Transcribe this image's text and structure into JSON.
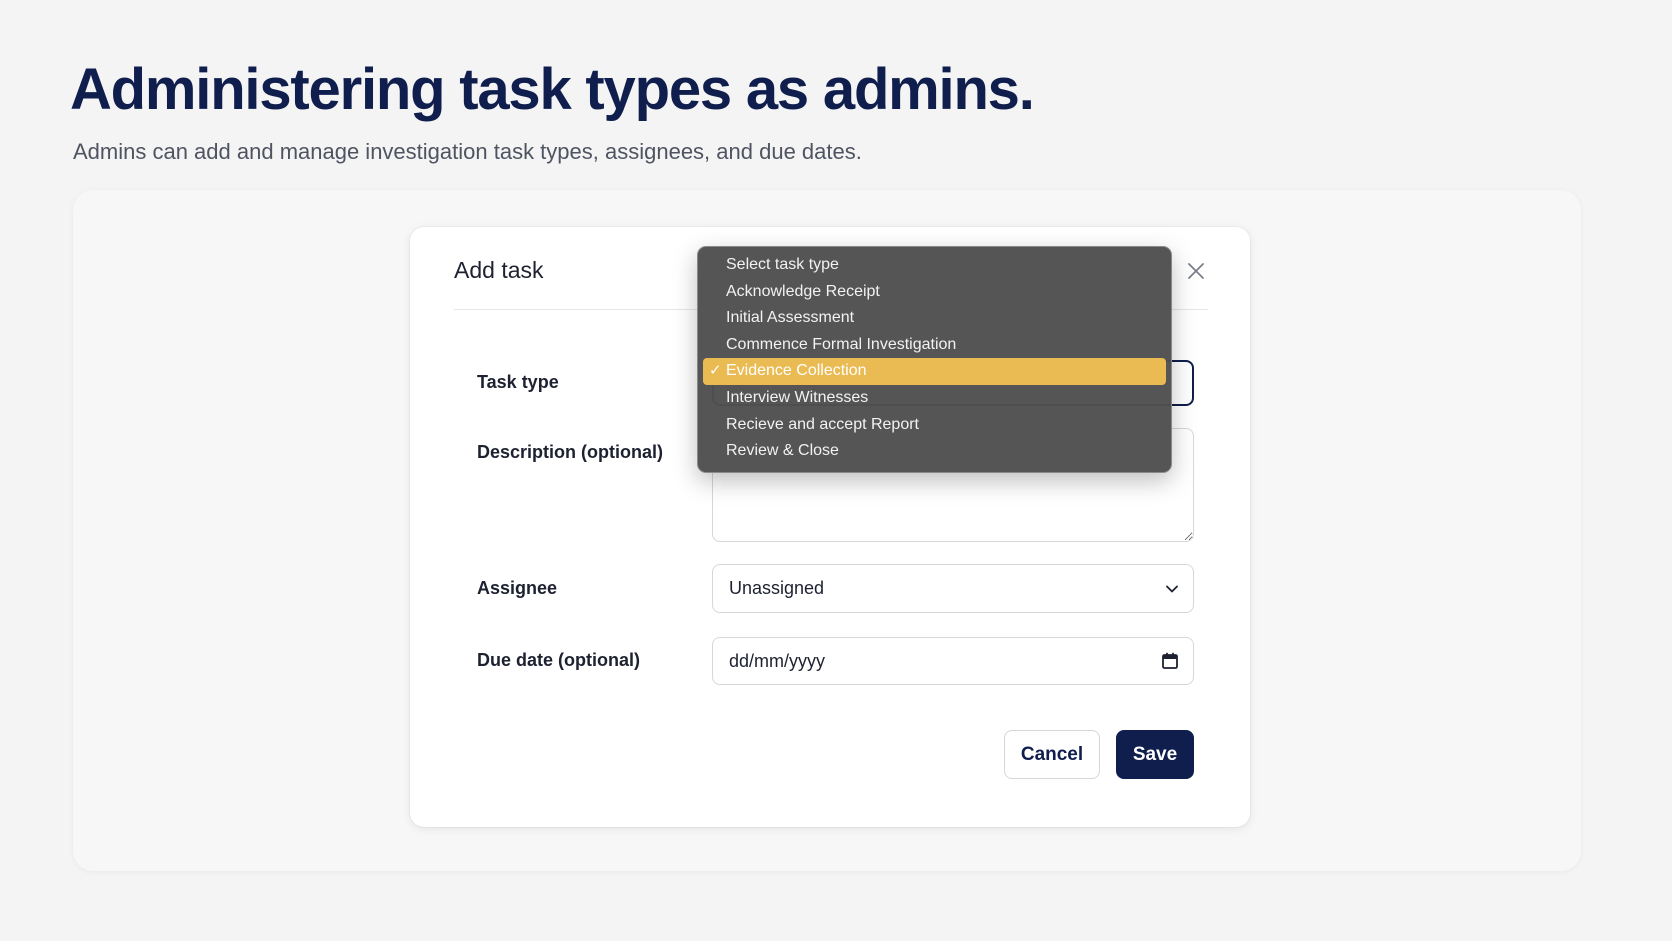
{
  "page": {
    "headline": "Administering task types as admins.",
    "subhead": "Admins can add and manage investigation task types, assignees, and due dates."
  },
  "dialog": {
    "title": "Add task",
    "close_icon": "close-icon",
    "fields": {
      "task_type_label": "Task type",
      "description_label": "Description (optional)",
      "description_value": "",
      "assignee_label": "Assignee",
      "assignee_value": "Unassigned",
      "due_label": "Due date (optional)",
      "due_placeholder": "dd/mm/yyyy"
    },
    "buttons": {
      "cancel": "Cancel",
      "save": "Save"
    }
  },
  "dropdown": {
    "selected_index": 4,
    "check_glyph": "✓",
    "options": [
      "Select task type",
      "Acknowledge Receipt",
      "Initial Assessment",
      "Commence Formal Investigation",
      "Evidence Collection",
      "Interview Witnesses",
      "Recieve and accept Report",
      "Review & Close"
    ]
  },
  "colors": {
    "brand_navy": "#0f1e4d",
    "highlight": "#ebbb53",
    "dropdown_bg": "#505050"
  }
}
